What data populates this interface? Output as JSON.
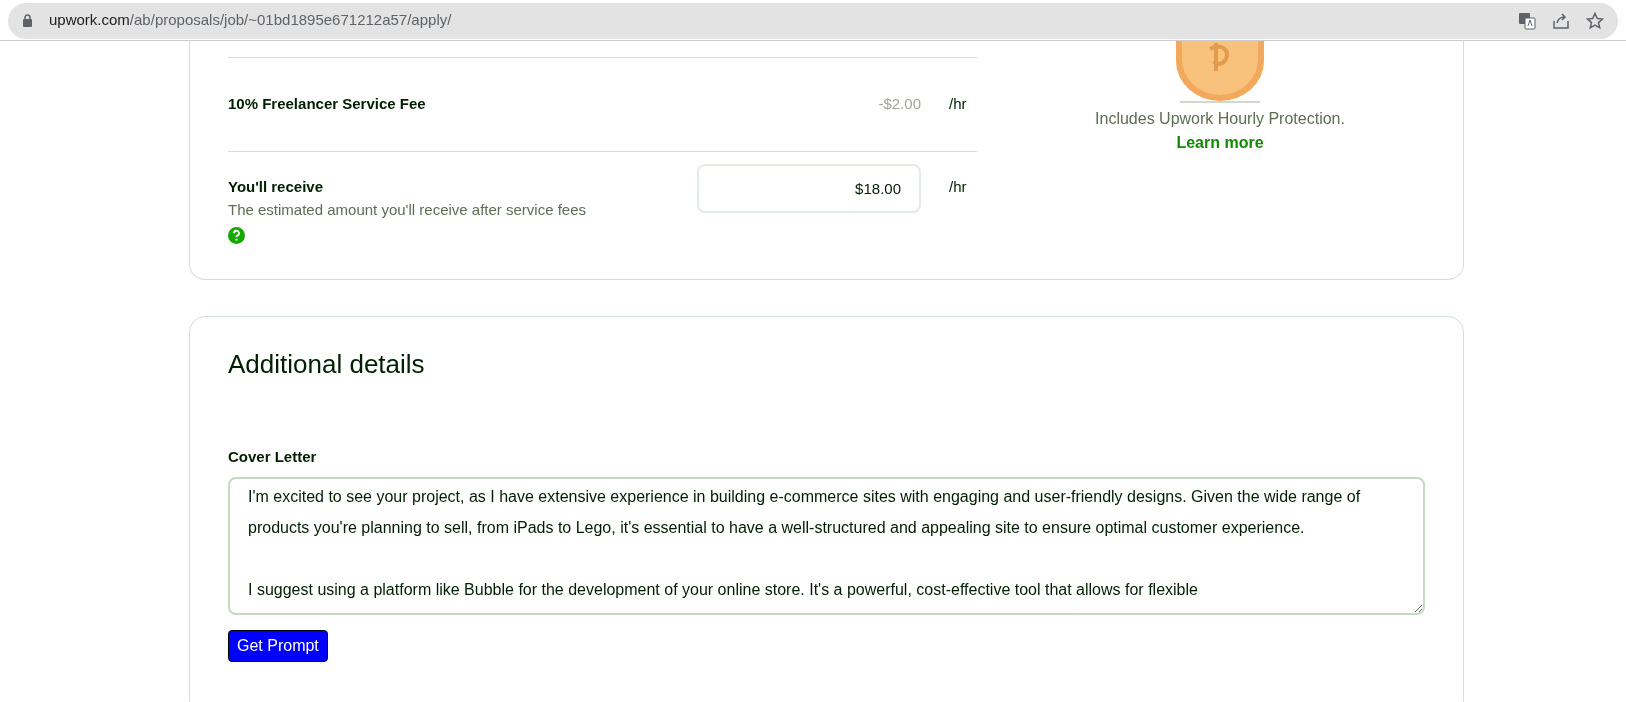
{
  "browser": {
    "url_host": "upwork.com",
    "url_path": "/ab/proposals/job/~01bd1895e671212a57/apply/"
  },
  "rate_card": {
    "fee_row": {
      "label": "10% Freelancer Service Fee",
      "amount": "-$2.00",
      "unit": "/hr"
    },
    "receive_row": {
      "label": "You'll receive",
      "description": "The estimated amount you'll receive after service fees",
      "value": "$18.00",
      "unit": "/hr"
    },
    "protection": {
      "text": "Includes Upwork Hourly Protection.",
      "link": "Learn more"
    }
  },
  "details_card": {
    "title": "Additional details",
    "cover_letter": {
      "label": "Cover Letter",
      "value": "I'm excited to see your project, as I have extensive experience in building e-commerce sites with engaging and user-friendly designs. Given the wide range of products you're planning to sell, from iPads to Lego, it's essential to have a well-structured and appealing site to ensure optimal customer experience.\n\nI suggest using a platform like Bubble for the development of your online store. It's a powerful, cost-effective tool that allows for flexible"
    },
    "button": "Get Prompt"
  }
}
